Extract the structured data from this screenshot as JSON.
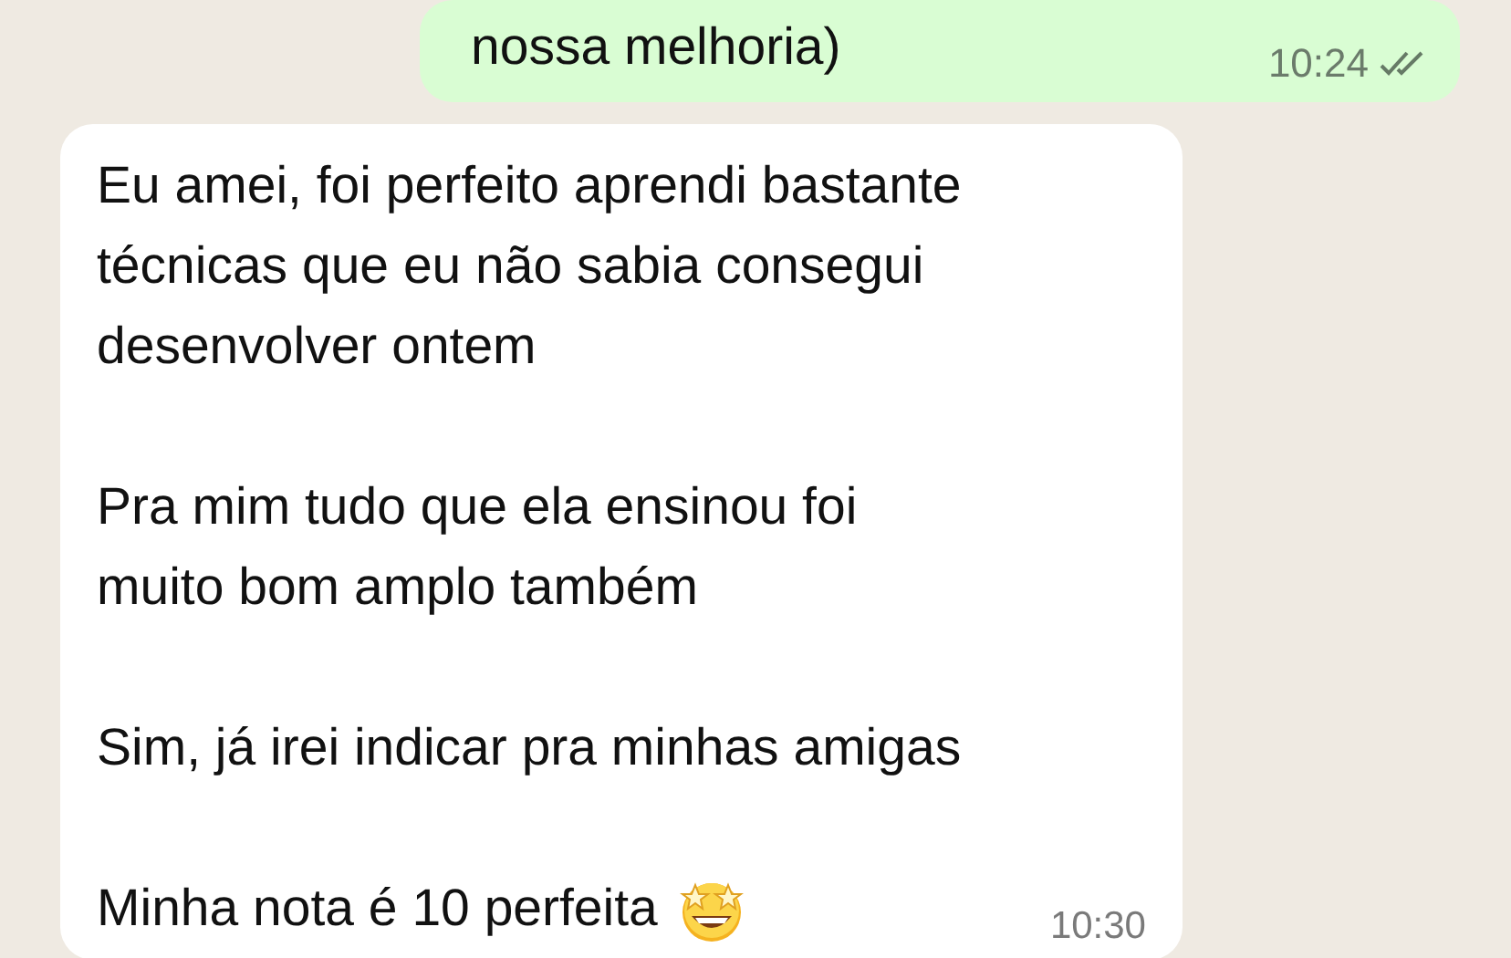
{
  "messages": [
    {
      "kind": "outgoing",
      "paragraphs": [
        "nossa melhoria)"
      ],
      "time": "10:24",
      "read": true
    },
    {
      "kind": "incoming",
      "paragraphs": [
        "Eu amei, foi perfeito aprendi bastante\ntécnicas que eu não sabia consegui\ndesenvolver ontem",
        "Pra mim tudo que ela ensinou foi\nmuito bom amplo também",
        "Sim, já irei indicar pra minhas amigas",
        "Minha nota é 10 perfeita"
      ],
      "emoji_end": true,
      "time": "10:30"
    }
  ]
}
